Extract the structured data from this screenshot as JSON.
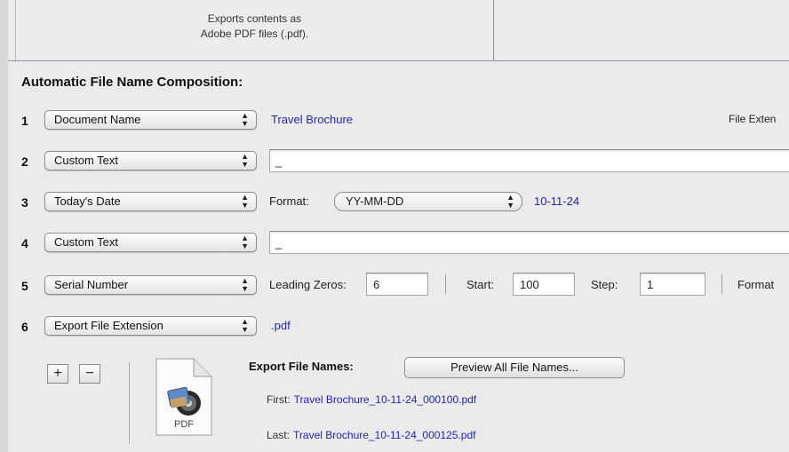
{
  "top_panel": {
    "description_line1": "Exports contents as",
    "description_line2": "Adobe PDF files (.pdf)."
  },
  "section_title": "Automatic File Name Composition:",
  "rows": [
    {
      "number": "1",
      "popup": "Document Name",
      "value": "Travel Brochure",
      "right_label": "File Exten"
    },
    {
      "number": "2",
      "popup": "Custom Text",
      "field_value": "_"
    },
    {
      "number": "3",
      "popup": "Today's Date",
      "format_label": "Format:",
      "format_value": "YY-MM-DD",
      "value": "10-11-24"
    },
    {
      "number": "4",
      "popup": "Custom Text",
      "field_value": "_"
    },
    {
      "number": "5",
      "popup": "Serial Number",
      "leading_zeros_label": "Leading Zeros:",
      "leading_zeros": "6",
      "start_label": "Start:",
      "start": "100",
      "step_label": "Step:",
      "step": "1",
      "right_label": "Format"
    },
    {
      "number": "6",
      "popup": "Export File Extension",
      "value": ".pdf"
    }
  ],
  "buttons": {
    "add": "+",
    "remove": "−",
    "preview": "Preview All File Names..."
  },
  "export": {
    "label": "Export File Names:",
    "first_label": "First:",
    "first_value": "Travel Brochure_10-11-24_000100.pdf",
    "last_label": "Last:",
    "last_value": "Travel Brochure_10-11-24_000125.pdf",
    "icon_caption": "PDF"
  },
  "colors": {
    "accent_text": "#2424b8",
    "panel_border": "#8f8fb8"
  },
  "icons": {
    "popup_arrows": "up-down-arrows-icon",
    "document": "pdf-document-icon"
  }
}
